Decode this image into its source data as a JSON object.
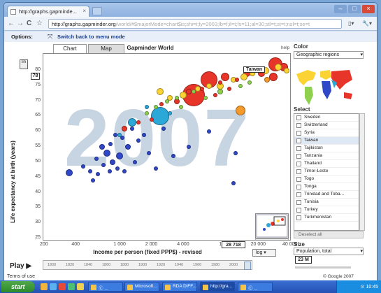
{
  "browser": {
    "tab_title": "http://graphs.gapminde...",
    "url_domain": "http://graphs.gapminder.org",
    "url_rest": "/world/#$majorMode=chart$is;shi=t;ly=2003;lb=f;il=t;fs=11;al=30;stl=t;st=t;nsl=t;se=t",
    "back_glyph": "←",
    "forward_glyph": "→",
    "reload_glyph": "C",
    "star_glyph": "☆",
    "page_menu": "▯▾",
    "tools_menu": "🔧▾",
    "min_glyph": "–",
    "max_glyph": "□",
    "close_glyph": "×"
  },
  "options": {
    "label": "Options:",
    "switch_link": "Switch back to menu mode"
  },
  "chart_tabs": [
    "Chart",
    "Map",
    "Gapminder World"
  ],
  "help_link": "help",
  "chart_data": {
    "type": "scatter",
    "year_watermark": "2007",
    "xlabel": "Income per person (fixed PPP$) - revised",
    "ylabel": "Life expectancy at birth (years)",
    "x_scale": "log",
    "x_scale_label": "log",
    "ylim": [
      25,
      85
    ],
    "xlim": [
      200,
      40000
    ],
    "y_ticks": [
      "80",
      "75",
      "70",
      "65",
      "60",
      "55",
      "50",
      "45",
      "40",
      "35",
      "30",
      "25"
    ],
    "x_ticks": [
      "200",
      "400",
      "1 000",
      "2 000",
      "4 000",
      "10 000",
      "20 000",
      "40 000"
    ],
    "y_readout": "78",
    "x_readout": "28 718",
    "highlight_label": "Taiwan",
    "points": [
      {
        "x": 28718,
        "y": 78.0,
        "s": 6,
        "c": "#e8352a"
      },
      {
        "x": 330,
        "y": 46.5,
        "s": 5,
        "c": "#3048c8"
      },
      {
        "x": 450,
        "y": 48.5,
        "s": 3,
        "c": "#3048c8"
      },
      {
        "x": 520,
        "y": 47,
        "s": 3,
        "c": "#3048c8"
      },
      {
        "x": 560,
        "y": 44,
        "s": 3,
        "c": "#3048c8"
      },
      {
        "x": 600,
        "y": 51,
        "s": 3,
        "c": "#3048c8"
      },
      {
        "x": 620,
        "y": 46,
        "s": 3,
        "c": "#3048c8"
      },
      {
        "x": 680,
        "y": 55,
        "s": 4,
        "c": "#3048c8"
      },
      {
        "x": 700,
        "y": 49,
        "s": 3,
        "c": "#3048c8"
      },
      {
        "x": 750,
        "y": 53,
        "s": 5,
        "c": "#3048c8"
      },
      {
        "x": 800,
        "y": 47,
        "s": 3,
        "c": "#3048c8"
      },
      {
        "x": 820,
        "y": 56,
        "s": 3,
        "c": "#3048c8"
      },
      {
        "x": 850,
        "y": 50,
        "s": 4,
        "c": "#3048c8"
      },
      {
        "x": 900,
        "y": 59,
        "s": 3,
        "c": "#3048c8"
      },
      {
        "x": 950,
        "y": 48,
        "s": 3,
        "c": "#3048c8"
      },
      {
        "x": 1000,
        "y": 52,
        "s": 5,
        "c": "#3048c8"
      },
      {
        "x": 1050,
        "y": 58,
        "s": 3,
        "c": "#3048c8"
      },
      {
        "x": 1100,
        "y": 47,
        "s": 3,
        "c": "#3048c8"
      },
      {
        "x": 1200,
        "y": 55,
        "s": 4,
        "c": "#3048c8"
      },
      {
        "x": 1300,
        "y": 61,
        "s": 3,
        "c": "#3048c8"
      },
      {
        "x": 1400,
        "y": 50,
        "s": 3,
        "c": "#3048c8"
      },
      {
        "x": 1500,
        "y": 57,
        "s": 3,
        "c": "#3048c8"
      },
      {
        "x": 1700,
        "y": 59,
        "s": 3,
        "c": "#3048c8"
      },
      {
        "x": 1900,
        "y": 53,
        "s": 3,
        "c": "#3048c8"
      },
      {
        "x": 2200,
        "y": 48,
        "s": 3,
        "c": "#3048c8"
      },
      {
        "x": 2600,
        "y": 61,
        "s": 3,
        "c": "#3048c8"
      },
      {
        "x": 3200,
        "y": 52,
        "s": 3,
        "c": "#3048c8"
      },
      {
        "x": 4500,
        "y": 55,
        "s": 3,
        "c": "#3048c8"
      },
      {
        "x": 7000,
        "y": 60,
        "s": 3,
        "c": "#3048c8"
      },
      {
        "x": 12000,
        "y": 43,
        "s": 3,
        "c": "#3048c8"
      },
      {
        "x": 12500,
        "y": 53,
        "s": 3,
        "c": "#3048c8"
      },
      {
        "x": 2400,
        "y": 65,
        "s": 13,
        "c": "#2ba7d8"
      },
      {
        "x": 1300,
        "y": 63,
        "s": 6,
        "c": "#2ba7d8"
      },
      {
        "x": 1000,
        "y": 59,
        "s": 3,
        "c": "#2ba7d8"
      },
      {
        "x": 1800,
        "y": 68,
        "s": 3,
        "c": "#2ba7d8"
      },
      {
        "x": 3000,
        "y": 66,
        "s": 3,
        "c": "#2ba7d8"
      },
      {
        "x": 5000,
        "y": 72,
        "s": 16,
        "c": "#e8352a"
      },
      {
        "x": 1100,
        "y": 61,
        "s": 4,
        "c": "#e8352a"
      },
      {
        "x": 1500,
        "y": 63,
        "s": 3,
        "c": "#e8352a"
      },
      {
        "x": 2000,
        "y": 64,
        "s": 3,
        "c": "#e8352a"
      },
      {
        "x": 2500,
        "y": 69,
        "s": 3,
        "c": "#e8352a"
      },
      {
        "x": 3500,
        "y": 70,
        "s": 4,
        "c": "#e8352a"
      },
      {
        "x": 4500,
        "y": 73,
        "s": 4,
        "c": "#e8352a"
      },
      {
        "x": 6000,
        "y": 74,
        "s": 3,
        "c": "#e8352a"
      },
      {
        "x": 7000,
        "y": 77,
        "s": 12,
        "c": "#e8352a"
      },
      {
        "x": 8000,
        "y": 72,
        "s": 3,
        "c": "#e8352a"
      },
      {
        "x": 9000,
        "y": 76,
        "s": 3,
        "c": "#e8352a"
      },
      {
        "x": 10000,
        "y": 78,
        "s": 6,
        "c": "#e8352a"
      },
      {
        "x": 11000,
        "y": 74,
        "s": 3,
        "c": "#e8352a"
      },
      {
        "x": 13000,
        "y": 77,
        "s": 3,
        "c": "#e8352a"
      },
      {
        "x": 16000,
        "y": 79,
        "s": 5,
        "c": "#e8352a"
      },
      {
        "x": 22000,
        "y": 79,
        "s": 5,
        "c": "#e8352a"
      },
      {
        "x": 30000,
        "y": 82,
        "s": 10,
        "c": "#e8352a"
      },
      {
        "x": 36000,
        "y": 81,
        "s": 6,
        "c": "#e8352a"
      },
      {
        "x": 2400,
        "y": 73,
        "s": 5,
        "c": "#fbd333"
      },
      {
        "x": 3000,
        "y": 71,
        "s": 4,
        "c": "#fbd333"
      },
      {
        "x": 4000,
        "y": 72,
        "s": 5,
        "c": "#fbd333"
      },
      {
        "x": 5500,
        "y": 74,
        "s": 4,
        "c": "#fbd333"
      },
      {
        "x": 7000,
        "y": 75,
        "s": 4,
        "c": "#fbd333"
      },
      {
        "x": 9000,
        "y": 75,
        "s": 5,
        "c": "#fbd333"
      },
      {
        "x": 12000,
        "y": 77,
        "s": 4,
        "c": "#fbd333"
      },
      {
        "x": 15000,
        "y": 78,
        "s": 5,
        "c": "#fbd333"
      },
      {
        "x": 18000,
        "y": 79,
        "s": 4,
        "c": "#fbd333"
      },
      {
        "x": 24000,
        "y": 80,
        "s": 5,
        "c": "#fbd333"
      },
      {
        "x": 32000,
        "y": 81,
        "s": 5,
        "c": "#fbd333"
      },
      {
        "x": 38000,
        "y": 80,
        "s": 4,
        "c": "#fbd333"
      },
      {
        "x": 2800,
        "y": 70,
        "s": 3,
        "c": "#8fd04f"
      },
      {
        "x": 3500,
        "y": 71,
        "s": 3,
        "c": "#8fd04f"
      },
      {
        "x": 5000,
        "y": 73,
        "s": 3,
        "c": "#8fd04f"
      },
      {
        "x": 6500,
        "y": 71,
        "s": 3,
        "c": "#8fd04f"
      },
      {
        "x": 9000,
        "y": 73,
        "s": 4,
        "c": "#8fd04f"
      },
      {
        "x": 14000,
        "y": 75,
        "s": 3,
        "c": "#8fd04f"
      },
      {
        "x": 17000,
        "y": 76,
        "s": 3,
        "c": "#8fd04f"
      },
      {
        "x": 2200,
        "y": 68,
        "s": 3,
        "c": "#8fd04f"
      },
      {
        "x": 1800,
        "y": 66,
        "s": 3,
        "c": "#8fd04f"
      },
      {
        "x": 3800,
        "y": 68,
        "s": 3,
        "c": "#8fd04f"
      },
      {
        "x": 14000,
        "y": 67,
        "s": 7,
        "c": "#f39a2a"
      },
      {
        "x": 25000,
        "y": 77,
        "s": 4,
        "c": "#f39a2a"
      }
    ]
  },
  "timeline": {
    "play_label": "Play",
    "years": [
      "1800",
      "1820",
      "1840",
      "1860",
      "1880",
      "1900",
      "1920",
      "1940",
      "1960",
      "1980",
      "2000"
    ]
  },
  "right_panel": {
    "color_label": "Color",
    "color_value": "Geographic regions",
    "select_label": "Select",
    "countries": [
      "Sweden",
      "Switzerland",
      "Syria",
      "Taiwan",
      "Tajikistan",
      "Tanzania",
      "Thailand",
      "Timor-Leste",
      "Togo",
      "Tonga",
      "Trinidad and Toba...",
      "Tunisia",
      "Turkey",
      "Turkmenistan"
    ],
    "selected_country": "Taiwan",
    "deselect_label": "Deselect all",
    "size_label": "Size",
    "size_value": "Population, total",
    "size_readout": "23 M"
  },
  "footer": {
    "terms": "Terms of use",
    "copyright": "© Google 2007"
  },
  "taskbar": {
    "start_label": "start",
    "buttons": [
      "Ⓒ ...",
      "Microsoft...",
      "RDA DiFF...",
      "http://gra...",
      "Ⓒ ..."
    ],
    "clock": "⊙ 10:45"
  }
}
